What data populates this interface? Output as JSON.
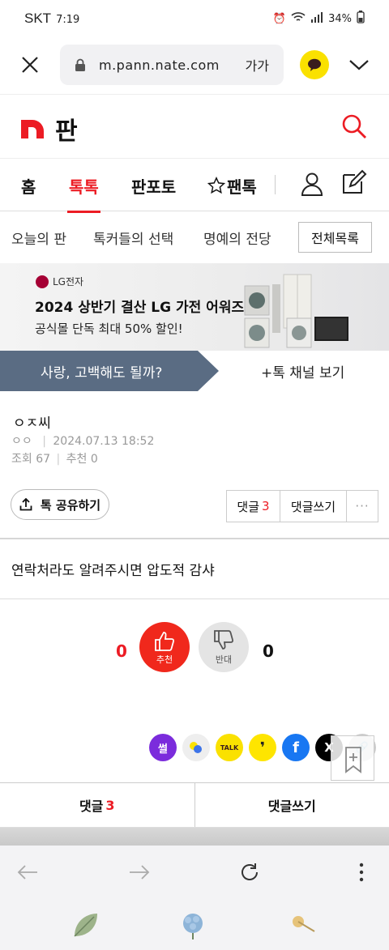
{
  "status": {
    "carrier": "SKT",
    "time": "7:19",
    "battery": "34%"
  },
  "browser": {
    "url": "m.pann.nate.com",
    "font_size_label": "가가"
  },
  "site": {
    "logo_text": "판"
  },
  "gnb": {
    "tabs": [
      "홈",
      "톡톡",
      "판포토",
      "팬톡"
    ],
    "active_tab": "톡톡"
  },
  "subnav": {
    "items": [
      "오늘의 판",
      "톡커들의 선택",
      "명예의 전당"
    ],
    "all_button": "전체목록"
  },
  "ad": {
    "brand": "LG전자",
    "headline": "2024 상반기 결산 LG 가전 어워즈",
    "subline": "공식몰 단독 최대 50% 할인!"
  },
  "channel": {
    "name": "사랑, 고백해도 될까?",
    "view_label": "+톡 채널 보기"
  },
  "post": {
    "title": "ㅇㅈ씨",
    "author": "ㅇㅇ",
    "date": "2024.07.13 18:52",
    "views_label": "조회",
    "views": "67",
    "recommend_label": "추천",
    "recommend": "0",
    "body": "연락처라도 알려주시면 압도적 감샤"
  },
  "actions": {
    "share_label": "톡 공유하기",
    "comment_label": "댓글",
    "comment_count": "3",
    "write_comment_label": "댓글쓰기",
    "more_label": "···"
  },
  "vote": {
    "up_label": "추천",
    "up_count": "0",
    "down_label": "반대",
    "down_count": "0"
  },
  "share_icons": [
    "썰",
    "톡",
    "TALK",
    "❜",
    "f",
    "X",
    "🔗"
  ],
  "colors": {
    "accent": "#ec1c24",
    "channel_bg": "#5a6c83",
    "kakao": "#fae100",
    "facebook": "#1877f2"
  }
}
